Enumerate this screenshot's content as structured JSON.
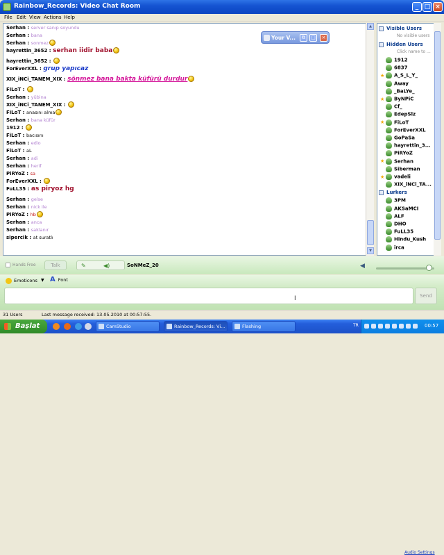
{
  "window": {
    "title": "Rainbow_Records: Video Chat Room"
  },
  "menu": [
    "File",
    "Edit",
    "View",
    "Actions",
    "Help"
  ],
  "video_window": {
    "title": "Your V..."
  },
  "messages": [
    {
      "nick": "Serhan :",
      "text": "server sanıp soyundu",
      "style": "purple",
      "smiley": false
    },
    {
      "nick": "Serhan :",
      "text": "bana",
      "style": "purple",
      "smiley": false
    },
    {
      "nick": "Serhan :",
      "text": "sonmez",
      "style": "purple",
      "smiley": true
    },
    {
      "nick": "hayrettin_3652 :",
      "text": "serhan iidir baba",
      "style": "big-darkred",
      "smiley": true
    },
    {
      "nick": "hayrettin_3652 :",
      "text": "",
      "style": "black",
      "smiley": true
    },
    {
      "nick": "ForEverXXL :",
      "text": "grup yapıcaz",
      "style": "big-blue",
      "smiley": false
    },
    {
      "nick": "XIX_iNCi_TANEM_XIX :",
      "text": "sönmez bana bakta küfürü durdur",
      "style": "big-magenta",
      "smiley": true
    },
    {
      "nick": "FiLoT :",
      "text": "",
      "style": "black",
      "smiley": true
    },
    {
      "nick": "Serhan :",
      "text": "yübina",
      "style": "purple",
      "smiley": false
    },
    {
      "nick": "XIX_iNCi_TANEM_XIX :",
      "text": "",
      "style": "black",
      "smiley": true
    },
    {
      "nick": "FiLoT :",
      "text": "anasını alma",
      "style": "black",
      "smiley": true
    },
    {
      "nick": "Serhan :",
      "text": "bana küfür",
      "style": "purple",
      "smiley": false
    },
    {
      "nick": "1912 :",
      "text": "",
      "style": "black",
      "smiley": true
    },
    {
      "nick": "FiLoT :",
      "text": "bacısını",
      "style": "black",
      "smiley": false
    },
    {
      "nick": "Serhan :",
      "text": "edio",
      "style": "purple",
      "smiley": false
    },
    {
      "nick": "FiLoT :",
      "text": "aL",
      "style": "black",
      "smiley": false
    },
    {
      "nick": "Serhan :",
      "text": "adi",
      "style": "purple",
      "smiley": false
    },
    {
      "nick": "Serhan :",
      "text": "herif",
      "style": "purple",
      "smiley": false
    },
    {
      "nick": "PiRYoZ :",
      "text": "sa",
      "style": "red",
      "smiley": false
    },
    {
      "nick": "ForEverXXL :",
      "text": "",
      "style": "black",
      "smiley": true
    },
    {
      "nick": "FuLL35 :",
      "text": "as piryoz hg",
      "style": "big-darkred",
      "smiley": false
    },
    {
      "nick": "Serhan :",
      "text": "gelse",
      "style": "purple",
      "smiley": false
    },
    {
      "nick": "Serhan :",
      "text": "nick ile",
      "style": "purple",
      "smiley": false
    },
    {
      "nick": "PiRYoZ :",
      "text": "hb",
      "style": "red",
      "smiley": true
    },
    {
      "nick": "Serhan :",
      "text": "anca",
      "style": "purple",
      "smiley": false
    },
    {
      "nick": "Serhan :",
      "text": "saklanır",
      "style": "purple",
      "smiley": false
    },
    {
      "nick": "sipercik :",
      "text": "at suratlı",
      "style": "black",
      "smiley": false
    }
  ],
  "users_panel": {
    "visible_header": "Visible Users",
    "visible_hint": "No visible users",
    "hidden_header": "Hidden Users",
    "hidden_hint": "Click name to ...",
    "hidden_users": [
      "1912",
      "6837",
      "A_S_L_Y_",
      "Away",
      "_BaLYe_",
      "ByNPiC",
      "Cf_",
      "EdepSlz",
      "FiLoT",
      "ForEverXXL",
      "GoPaSa",
      "hayrettin_3...",
      "PiRYoZ",
      "Serhan",
      "Siberman",
      "vadeli",
      "XIX_iNCi_TA..."
    ],
    "lurkers_header": "Lurkers",
    "lurkers": [
      "3PM",
      "AKSaMCI",
      "ALF",
      "DHO",
      "FuLL35",
      "Hindu_Kush",
      "irca"
    ]
  },
  "voice": {
    "hands_free": "Hands Free",
    "talk": "Talk",
    "speaker": "SoNMeZ_20",
    "audio_settings": "Audio Settings"
  },
  "toolbar": {
    "emoticons": "Emoticons",
    "font": "Font"
  },
  "input": {
    "send": "Send"
  },
  "status": {
    "users": "31 Users",
    "last_message": "Last message received: 13.05.2010 at 00:57:55."
  },
  "taskbar": {
    "start": "Başlat",
    "tasks": [
      "CamStudio",
      "Rainbow_Records: Vi...",
      "Flashing"
    ],
    "lang": "TR",
    "clock": "00:57"
  },
  "colors": {
    "purple": "#b07fcf",
    "darkred": "#a0102c",
    "blue": "#1a3ac8",
    "magenta": "#d4189a",
    "red": "#c01010"
  }
}
